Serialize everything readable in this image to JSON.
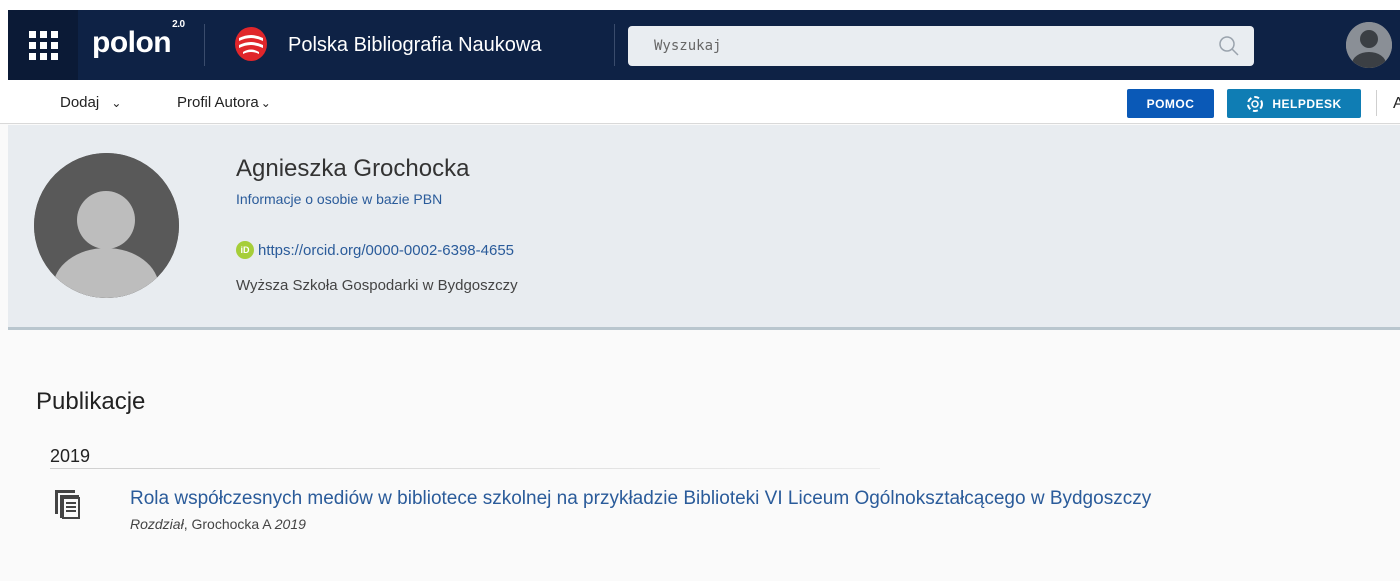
{
  "header": {
    "logo_text": "polon",
    "logo_version": "2.0",
    "app_name": "Polska Bibliografia Naukowa",
    "search_placeholder": "Wyszukaj",
    "icons": [
      "apps-grid-icon",
      "pbn-logo-icon",
      "search-icon",
      "user-avatar-icon"
    ]
  },
  "menu": {
    "dodaj_label": "Dodaj",
    "dodaj_caret": "⌄",
    "profil_label": "Profil Autora",
    "profil_caret": "⌄",
    "pomoc_label": "POMOC",
    "helpdesk_label": "HELPDESK",
    "cut_off_text": "A"
  },
  "profile": {
    "name": "Agnieszka Grochocka",
    "info_link": "Informacje o osobie w bazie PBN",
    "orcid_badge": "iD",
    "orcid_url": "https://orcid.org/0000-0002-6398-4655",
    "affiliation": "Wyższa Szkoła Gospodarki w Bydgoszczy"
  },
  "publications": {
    "heading": "Publikacje",
    "groups": [
      {
        "year": "2019",
        "items": [
          {
            "title": "Rola współczesnych mediów w bibliotece szkolnej na przykładzie Biblioteki VI Liceum Ogólnokształcącego w Bydgoszczy",
            "type": "Rozdział",
            "author": ", Grochocka A ",
            "year": "2019"
          }
        ]
      }
    ]
  },
  "colors": {
    "header_bg": "#0e2245",
    "link": "#2a5b9a",
    "pomoc_bg": "#0a59b7",
    "helpdesk_bg": "#0f7db4",
    "profile_bg": "#e8ecf0",
    "orcid_green": "#a6ce39",
    "pbn_red": "#e0262b"
  }
}
